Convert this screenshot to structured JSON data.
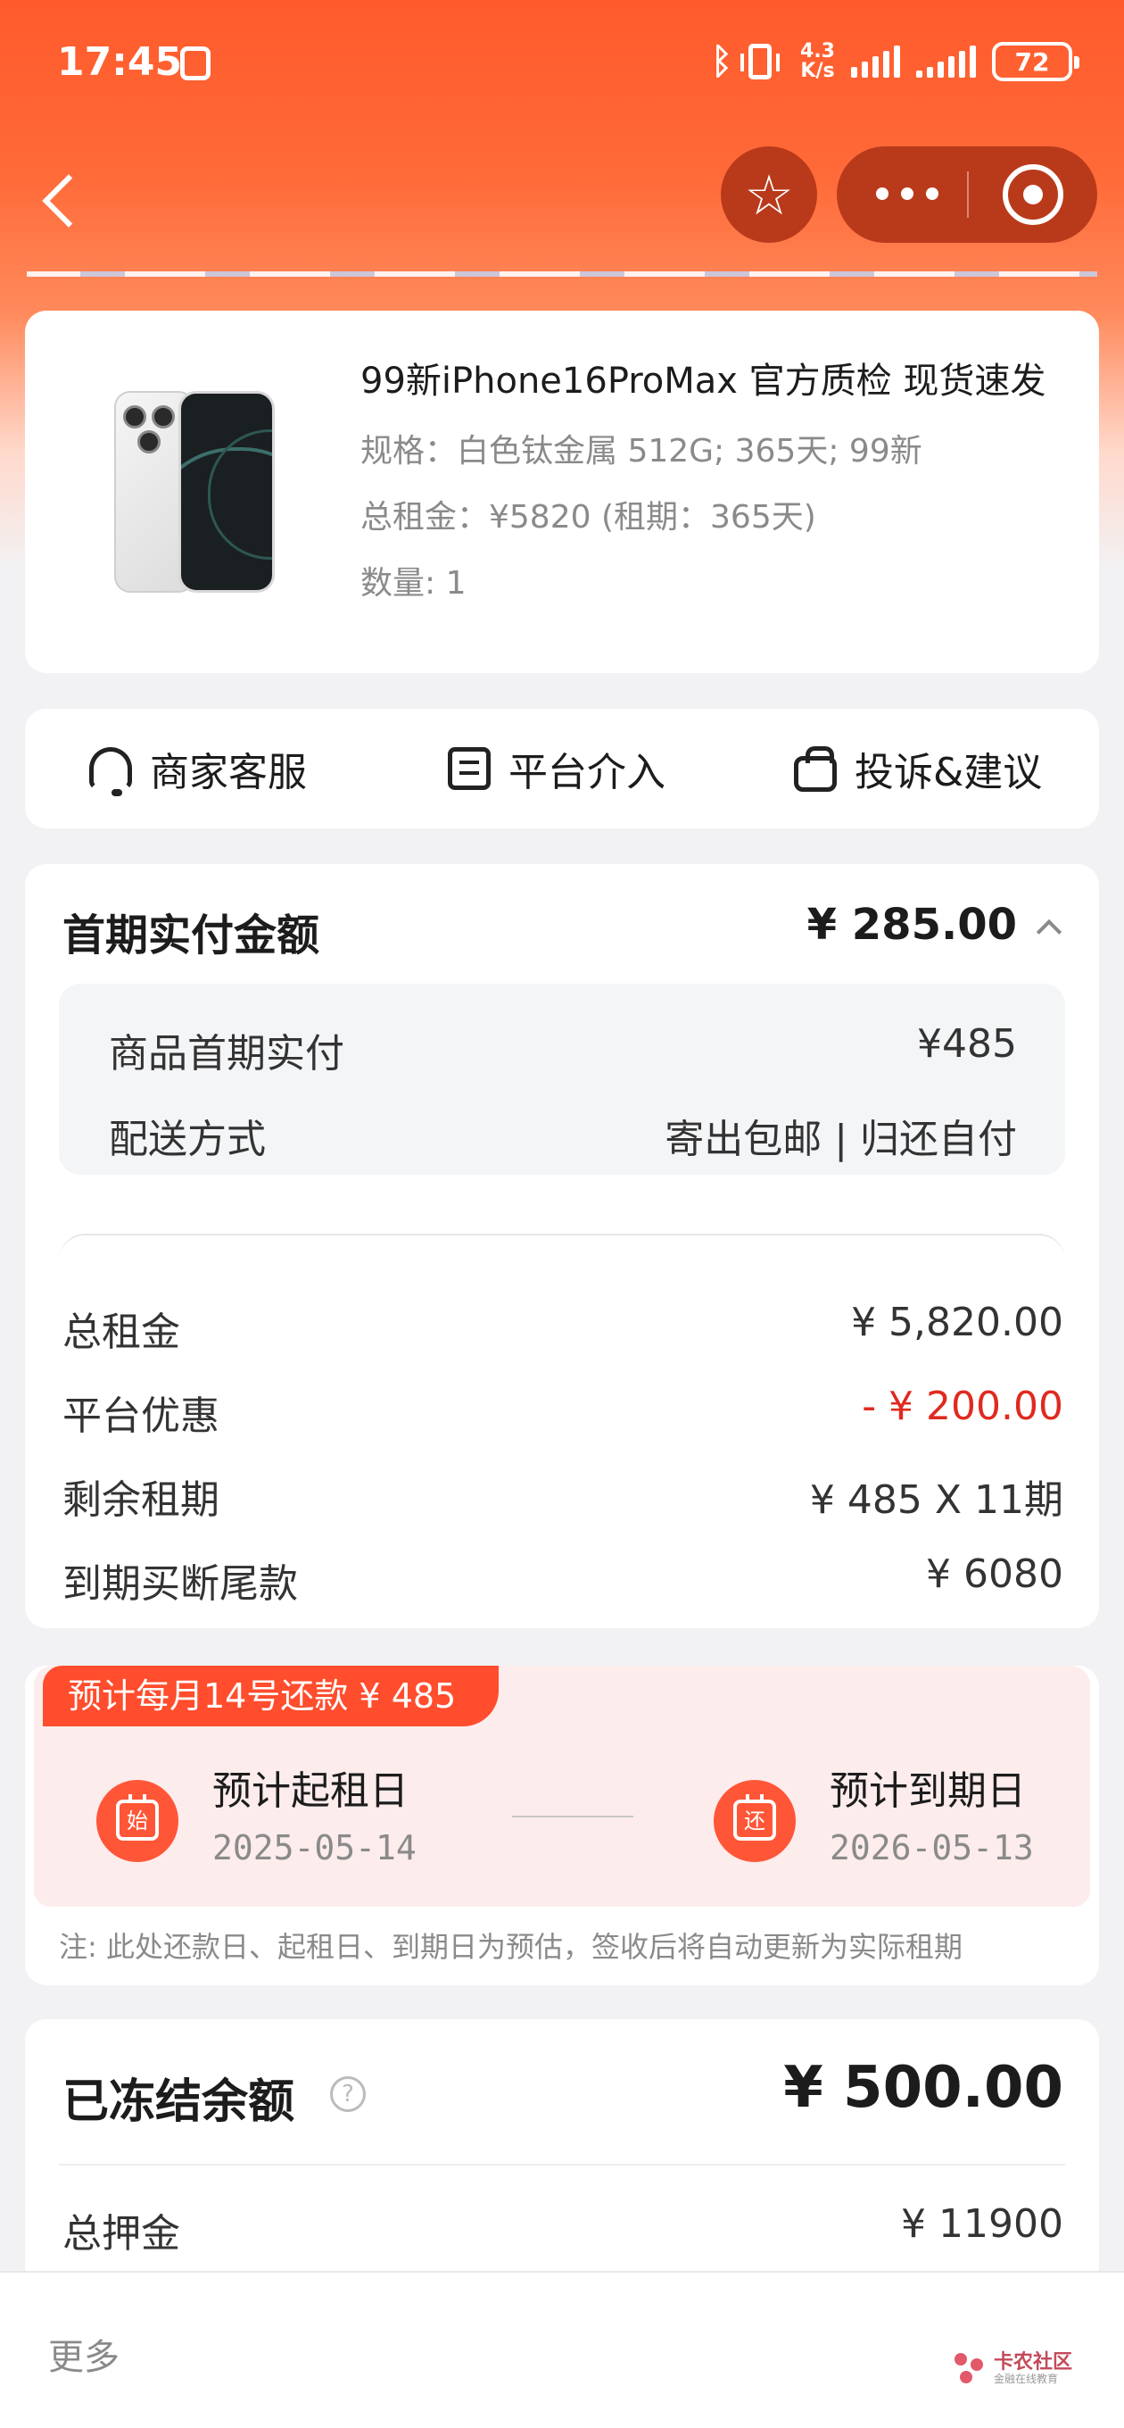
{
  "status_bar": {
    "time": "17:45",
    "net_speed_value": "4.3",
    "net_speed_unit": "K/s",
    "battery": "72"
  },
  "nav": {
    "back_icon": "chevron-left-icon",
    "star_icon": "star-icon",
    "more_icon": "more-dots-icon",
    "target_icon": "target-icon"
  },
  "product": {
    "title": "99新iPhone16ProMax 官方质检 现货速发",
    "spec": "规格：白色钛金属 512G; 365天; 99新",
    "total_rent": "总租金：¥5820 (租期：365天)",
    "quantity": "数量: 1"
  },
  "services": [
    {
      "label": "商家客服",
      "icon": "headset-icon"
    },
    {
      "label": "平台介入",
      "icon": "message-icon"
    },
    {
      "label": "投诉&建议",
      "icon": "bag-icon"
    }
  ],
  "payment": {
    "title": "首期实付金额",
    "amount": "¥ 285.00",
    "details": [
      {
        "label": "商品首期实付",
        "value": "¥485"
      },
      {
        "label": "配送方式",
        "value": "寄出包邮 | 归还自付"
      }
    ],
    "rows": [
      {
        "label": "总租金",
        "value": "¥ 5,820.00"
      },
      {
        "label": "平台优惠",
        "value": "- ¥ 200.00"
      },
      {
        "label": "剩余租期",
        "value": "¥ 485 X 11期"
      },
      {
        "label": "到期买断尾款",
        "value": "¥ 6080"
      }
    ]
  },
  "schedule": {
    "badge": "预计每月14号还款 ¥ 485",
    "start_icon_text": "始",
    "start_label": "预计起租日",
    "start_date": "2025-05-14",
    "end_icon_text": "还",
    "end_label": "预计到期日",
    "end_date": "2026-05-13",
    "note": "注: 此处还款日、起租日、到期日为预估，签收后将自动更新为实际租期"
  },
  "frozen": {
    "title": "已冻结余额",
    "help": "?",
    "amount": "¥ 500.00",
    "deposit_label": "总押金",
    "deposit_value": "¥ 11900"
  },
  "bottom": {
    "more_label": "更多",
    "watermark_name": "卡农社区",
    "watermark_sub": "金融在线教育"
  },
  "colors": {
    "header_orange": "#ff5a2c",
    "discount_red": "#e02a1f",
    "schedule_bg": "#fdecec",
    "badge_red": "#ff4d2d"
  }
}
